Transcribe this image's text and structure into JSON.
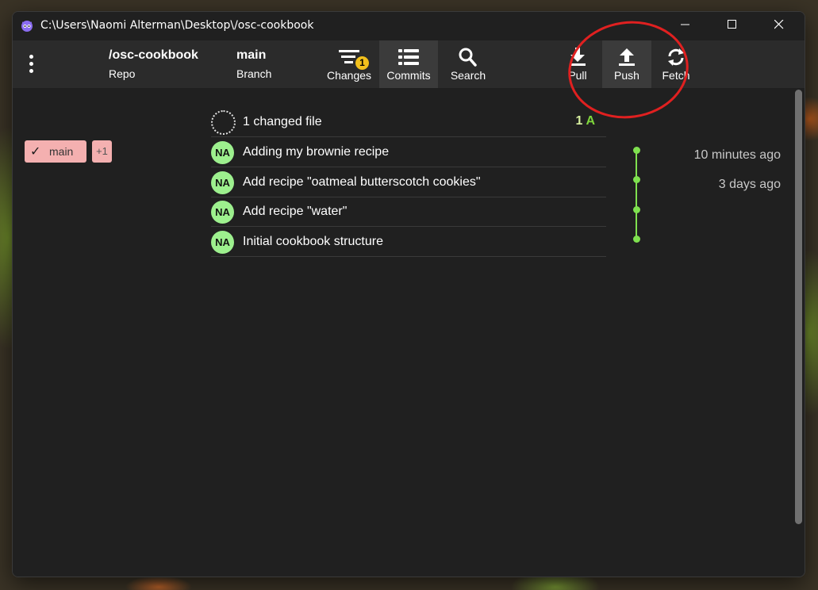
{
  "window": {
    "title": "C:\\Users\\Naomi Alterman\\Desktop\\/osc-cookbook",
    "controls": [
      "minimize",
      "maximize",
      "close"
    ]
  },
  "toolbar": {
    "repo_value": "/osc-cookbook",
    "repo_label": "Repo",
    "branch_value": "main",
    "branch_label": "Branch",
    "buttons": [
      {
        "label": "Changes",
        "icon": "changes-icon",
        "badge": "1"
      },
      {
        "label": "Commits",
        "icon": "commits-icon",
        "active": true
      },
      {
        "label": "Search",
        "icon": "search-icon"
      },
      {
        "label": "Pull",
        "icon": "pull-icon"
      },
      {
        "label": "Push",
        "icon": "push-icon"
      },
      {
        "label": "Fetch",
        "icon": "fetch-icon"
      }
    ]
  },
  "sidebar": {
    "branch_check": "✓",
    "branch_name": "main",
    "extra_refs": "+1"
  },
  "changes_row": {
    "text": "1 changed file",
    "count": "1",
    "status": "A"
  },
  "commits": [
    {
      "avatar": "NA",
      "message": "Adding my brownie recipe",
      "time": "10 minutes ago"
    },
    {
      "avatar": "NA",
      "message": "Add recipe \"oatmeal butterscotch cookies\"",
      "time": "3 days ago"
    },
    {
      "avatar": "NA",
      "message": "Add recipe \"water\"",
      "time": ""
    },
    {
      "avatar": "NA",
      "message": "Initial cookbook structure",
      "time": ""
    }
  ],
  "colors": {
    "accent_green": "#7fe04f",
    "avatar_green": "#9df08e",
    "branch_tag": "#f4b0b0",
    "badge_yellow": "#f2c01c",
    "annotation_red": "#e02020"
  }
}
